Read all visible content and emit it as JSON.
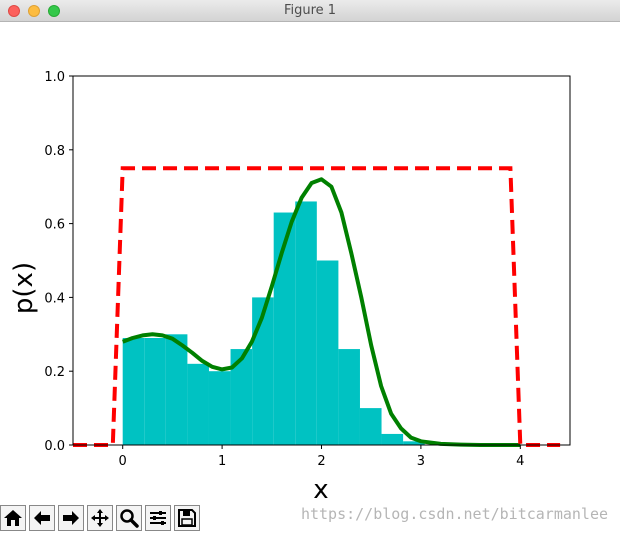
{
  "window": {
    "title": "Figure 1"
  },
  "colors": {
    "histogram": "#00c2c2",
    "density": "#008000",
    "uniform": "#ff0000"
  },
  "chart_data": {
    "type": "bar",
    "xlabel": "x",
    "ylabel": "p(x)",
    "xlim": [
      -0.5,
      4.5
    ],
    "ylim": [
      0.0,
      1.0
    ],
    "xticks": [
      0,
      1,
      2,
      3,
      4
    ],
    "yticks": [
      0.0,
      0.2,
      0.4,
      0.6,
      0.8,
      1.0
    ],
    "histogram": {
      "bin_edges": [
        0.0,
        0.217,
        0.434,
        0.651,
        0.868,
        1.085,
        1.302,
        1.519,
        1.736,
        1.953,
        2.17,
        2.387,
        2.604,
        2.821,
        3.038
      ],
      "values": [
        0.29,
        0.29,
        0.3,
        0.22,
        0.2,
        0.26,
        0.4,
        0.63,
        0.66,
        0.5,
        0.26,
        0.1,
        0.03,
        0.01
      ]
    },
    "series": [
      {
        "type": "line",
        "style": "solid",
        "x": [
          0.0,
          0.1,
          0.2,
          0.3,
          0.4,
          0.5,
          0.6,
          0.7,
          0.8,
          0.9,
          1.0,
          1.1,
          1.2,
          1.3,
          1.4,
          1.5,
          1.6,
          1.7,
          1.8,
          1.9,
          2.0,
          2.1,
          2.2,
          2.3,
          2.4,
          2.5,
          2.6,
          2.7,
          2.8,
          2.9,
          3.0,
          3.2,
          3.4,
          3.6,
          3.8,
          4.0
        ],
        "y": [
          0.28,
          0.29,
          0.297,
          0.3,
          0.297,
          0.288,
          0.27,
          0.25,
          0.228,
          0.212,
          0.205,
          0.21,
          0.235,
          0.28,
          0.345,
          0.43,
          0.52,
          0.605,
          0.67,
          0.71,
          0.72,
          0.7,
          0.63,
          0.52,
          0.4,
          0.27,
          0.16,
          0.085,
          0.045,
          0.02,
          0.01,
          0.003,
          0.001,
          0.0,
          0.0,
          0.0
        ]
      },
      {
        "type": "line",
        "style": "dashed",
        "x": [
          -0.5,
          -0.1,
          0.0,
          3.9,
          4.0,
          4.4
        ],
        "y": [
          0.0,
          0.0,
          0.75,
          0.75,
          0.0,
          0.0
        ]
      }
    ]
  },
  "toolbar": {
    "buttons": [
      {
        "icon": "home-icon"
      },
      {
        "icon": "back-arrow-icon"
      },
      {
        "icon": "forward-arrow-icon"
      },
      {
        "icon": "pan-icon"
      },
      {
        "icon": "zoom-icon"
      },
      {
        "icon": "subplots-icon"
      },
      {
        "icon": "save-icon"
      }
    ]
  },
  "watermark": "https://blog.csdn.net/bitcarmanlee"
}
